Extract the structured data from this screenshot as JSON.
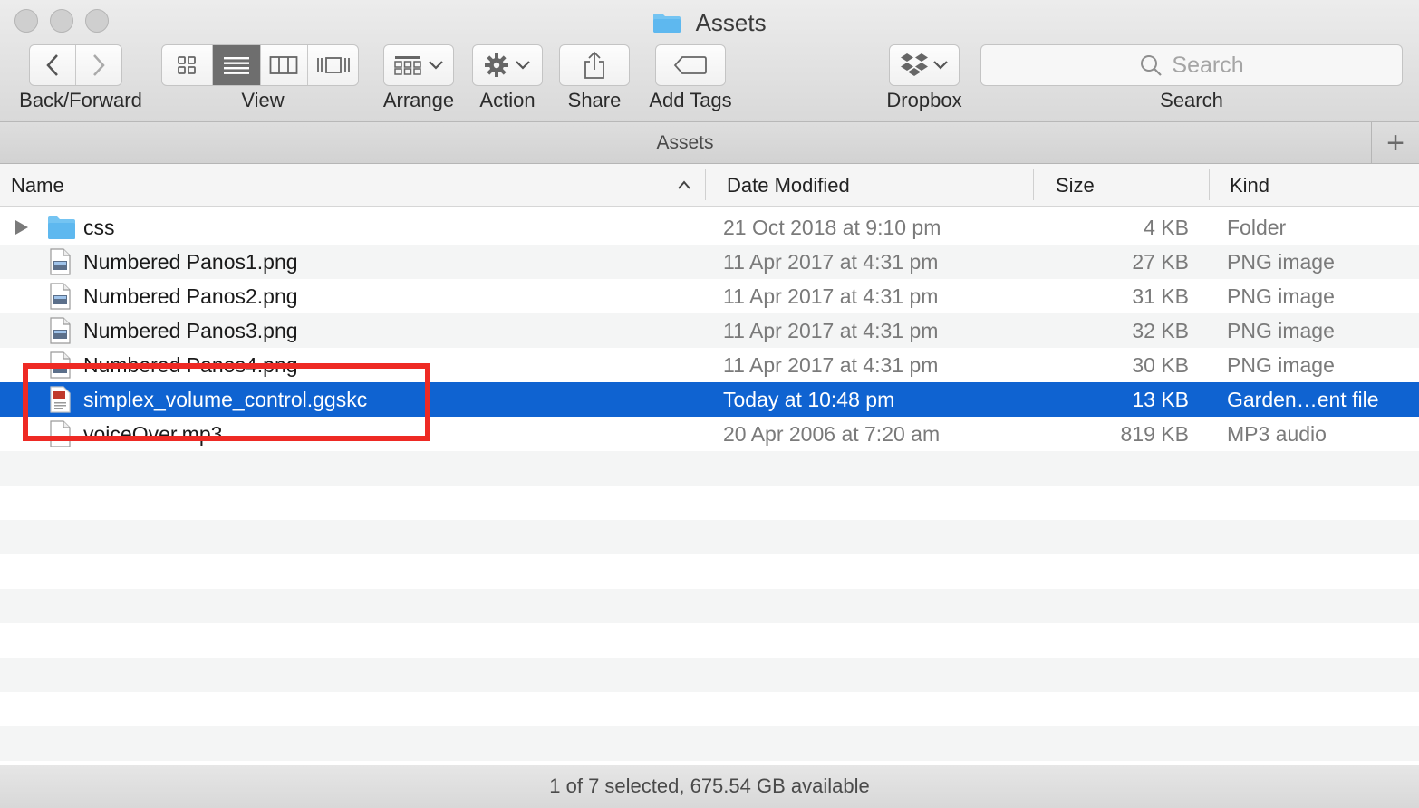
{
  "window": {
    "title": "Assets"
  },
  "toolbar": {
    "back_forward_label": "Back/Forward",
    "view_label": "View",
    "arrange_label": "Arrange",
    "action_label": "Action",
    "share_label": "Share",
    "add_tags_label": "Add Tags",
    "dropbox_label": "Dropbox",
    "search_label": "Search",
    "search_placeholder": "Search",
    "active_view": "list"
  },
  "pathbar": {
    "title": "Assets",
    "add_symbol": "+"
  },
  "columns": {
    "name": "Name",
    "date_modified": "Date Modified",
    "size": "Size",
    "kind": "Kind",
    "sort_indicator": "^"
  },
  "files": [
    {
      "name": "css",
      "date": "21 Oct 2018 at 9:10 pm",
      "size": "4 KB",
      "kind": "Folder",
      "icon": "folder-icon",
      "selected": false
    },
    {
      "name": "Numbered Panos1.png",
      "date": "11 Apr 2017 at 4:31 pm",
      "size": "27 KB",
      "kind": "PNG image",
      "icon": "png-file-icon",
      "selected": false
    },
    {
      "name": "Numbered Panos2.png",
      "date": "11 Apr 2017 at 4:31 pm",
      "size": "31 KB",
      "kind": "PNG image",
      "icon": "png-file-icon",
      "selected": false
    },
    {
      "name": "Numbered Panos3.png",
      "date": "11 Apr 2017 at 4:31 pm",
      "size": "32 KB",
      "kind": "PNG image",
      "icon": "png-file-icon",
      "selected": false
    },
    {
      "name": "Numbered Panos4.png",
      "date": "11 Apr 2017 at 4:31 pm",
      "size": "30 KB",
      "kind": "PNG image",
      "icon": "png-file-icon",
      "selected": false
    },
    {
      "name": "simplex_volume_control.ggskc",
      "date": "Today at 10:48 pm",
      "size": "13 KB",
      "kind": "Garden…ent file",
      "icon": "ggskc-file-icon",
      "selected": true
    },
    {
      "name": "voiceOver.mp3",
      "date": "20 Apr 2006 at 7:20 am",
      "size": "819 KB",
      "kind": "MP3 audio",
      "icon": "mp3-file-icon",
      "selected": false
    }
  ],
  "status": {
    "text": "1 of 7 selected, 675.54 GB available"
  },
  "colors": {
    "selection": "#0f63d1",
    "highlight_box": "#ee2a24",
    "folder": "#5eb8ef"
  }
}
